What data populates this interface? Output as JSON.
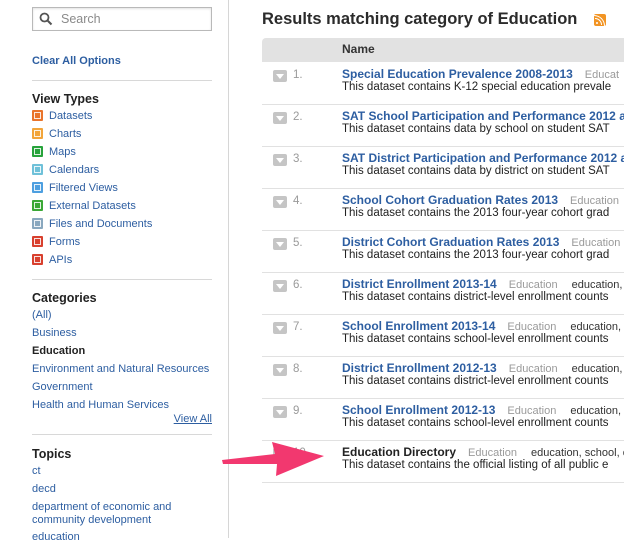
{
  "sidebar": {
    "search_placeholder": "Search",
    "clear_all": "Clear All Options",
    "view_types_title": "View Types",
    "view_types": [
      {
        "label": "Datasets",
        "icon": "datasets-icon",
        "color": "#e9742b"
      },
      {
        "label": "Charts",
        "icon": "charts-icon",
        "color": "#f2a53a"
      },
      {
        "label": "Maps",
        "icon": "maps-icon",
        "color": "#27a33b"
      },
      {
        "label": "Calendars",
        "icon": "calendars-icon",
        "color": "#6fc1d9"
      },
      {
        "label": "Filtered Views",
        "icon": "filtered-views-icon",
        "color": "#4d9fe0"
      },
      {
        "label": "External Datasets",
        "icon": "external-datasets-icon",
        "color": "#3aa836"
      },
      {
        "label": "Files and Documents",
        "icon": "files-icon",
        "color": "#8aa8bf"
      },
      {
        "label": "Forms",
        "icon": "forms-icon",
        "color": "#d8402e"
      },
      {
        "label": "APIs",
        "icon": "apis-icon",
        "color": "#d8402e"
      }
    ],
    "categories_title": "Categories",
    "categories": [
      {
        "label": "(All)",
        "selected": false
      },
      {
        "label": "Business",
        "selected": false
      },
      {
        "label": "Education",
        "selected": true
      },
      {
        "label": "Environment and Natural Resources",
        "selected": false
      },
      {
        "label": "Government",
        "selected": false
      },
      {
        "label": "Health and Human Services",
        "selected": false
      }
    ],
    "view_all": "View All",
    "topics_title": "Topics",
    "topics": [
      "ct",
      "decd",
      "department of economic and community development",
      "education"
    ]
  },
  "main": {
    "title": "Results matching category of Education",
    "rss_icon": "rss-icon",
    "column_name": "Name",
    "results": [
      {
        "num": "1.",
        "name": "Special Education Prevalence 2008-2013",
        "category": "Educat",
        "tags": "",
        "desc": "This dataset contains K-12 special education prevale"
      },
      {
        "num": "2.",
        "name": "SAT School Participation and Performance 2012 a",
        "category": "",
        "tags": "",
        "desc": "This dataset contains data by school on student SAT"
      },
      {
        "num": "3.",
        "name": "SAT District Participation and Performance 2012 a",
        "category": "",
        "tags": "",
        "desc": "This dataset contains data by district on student SAT"
      },
      {
        "num": "4.",
        "name": "School Cohort Graduation Rates 2013",
        "category": "Education",
        "tags": "",
        "desc": "This dataset contains the 2013 four-year cohort grad"
      },
      {
        "num": "5.",
        "name": "District Cohort Graduation Rates 2013",
        "category": "Education",
        "tags": "",
        "desc": "This dataset contains the 2013 four-year cohort grad"
      },
      {
        "num": "6.",
        "name": "District Enrollment 2013-14",
        "category": "Education",
        "tags": "education,",
        "desc": "This dataset contains district-level enrollment counts"
      },
      {
        "num": "7.",
        "name": "School Enrollment 2013-14",
        "category": "Education",
        "tags": "education,",
        "desc": "This dataset contains school-level enrollment counts"
      },
      {
        "num": "8.",
        "name": "District Enrollment 2012-13",
        "category": "Education",
        "tags": "education,",
        "desc": "This dataset contains district-level enrollment counts"
      },
      {
        "num": "9.",
        "name": "School Enrollment 2012-13",
        "category": "Education",
        "tags": "education,",
        "desc": "This dataset contains school-level enrollment counts"
      },
      {
        "num": "10.",
        "name": "Education Directory",
        "category": "Education",
        "tags": "education, school, e",
        "desc": "This dataset contains the official listing of all public e"
      }
    ]
  },
  "annotation": {
    "arrow_color": "#f2386f"
  }
}
